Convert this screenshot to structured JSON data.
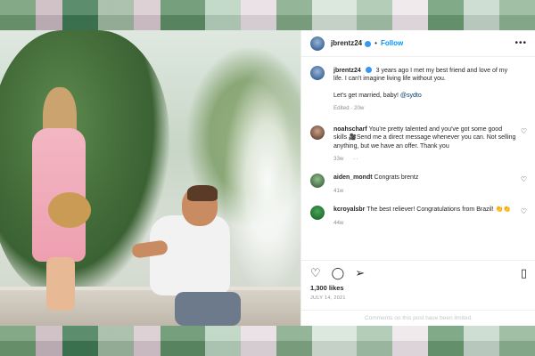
{
  "post": {
    "author": "jbrentz24",
    "follow_label": "Follow",
    "more_icon": "more-horizontal-icon",
    "caption": {
      "username": "jbrentz24",
      "text": "3 years ago I met my best friend and love of my life. I can't imagine living life without you.",
      "text2_prefix": "Let's get married, baby! ",
      "mention": "@sydto",
      "meta": "Edited · 20w"
    },
    "comments": [
      {
        "username": "noahscharf",
        "text": "You're pretty talented and you've got some good skills 🎥Send me a direct message whenever you can. Not selling anything, but we have an offer. Thank you",
        "time": "33w",
        "extra": "···"
      },
      {
        "username": "aiden_mondt",
        "text": "Congrats brentz",
        "time": "41w"
      },
      {
        "username": "kcroyalsbr",
        "text": "The best reliever! Congratulations from Brazil! 👏👏",
        "time": "44w"
      }
    ],
    "likes": "1,300 likes",
    "date": "JULY 14, 2021",
    "comments_limited": "Comments on this post have been limited.",
    "colors": {
      "link": "#0095f6",
      "verified": "#3897f0",
      "text": "#262626",
      "muted": "#8e8e8e"
    }
  }
}
